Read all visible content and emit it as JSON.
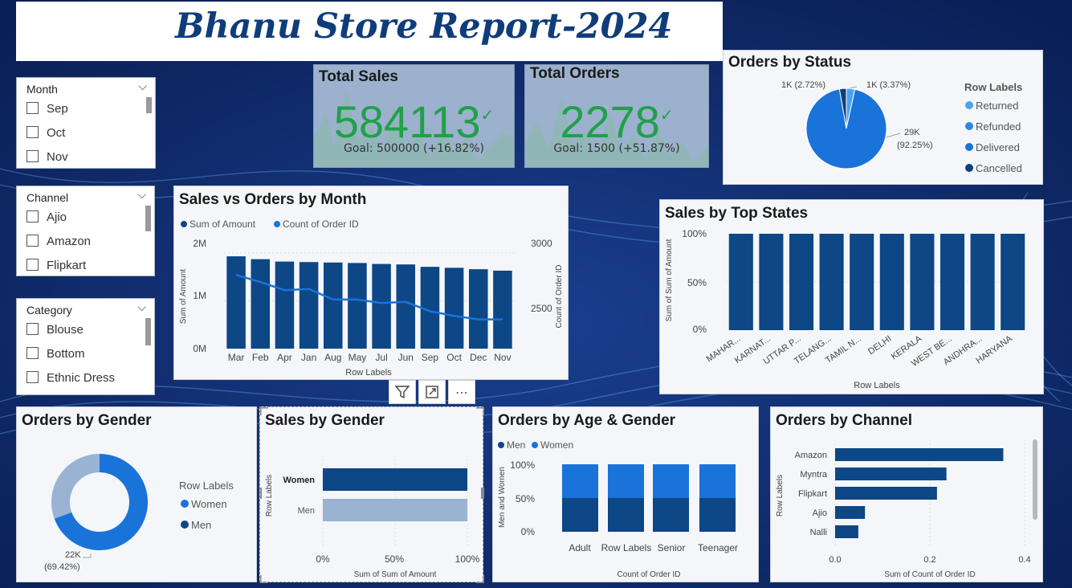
{
  "report_title": "Bhanu Store Report-2024",
  "colors": {
    "dark_blue": "#0d4785",
    "mid_blue": "#1a73d9",
    "light_blue": "#4aa3f0",
    "pale_blue": "#9ab3d3",
    "green": "#20a04a"
  },
  "slicers": [
    {
      "header": "Month",
      "items": [
        "Sep",
        "Oct",
        "Nov"
      ]
    },
    {
      "header": "Channel",
      "items": [
        "Ajio",
        "Amazon",
        "Flipkart"
      ]
    },
    {
      "header": "Category",
      "items": [
        "Blouse",
        "Bottom",
        "Ethnic Dress"
      ]
    }
  ],
  "kpis": {
    "sales": {
      "title": "Total Sales",
      "value": "584113",
      "goal": "Goal: 500000 (+16.82%)",
      "check_icon": "check-icon"
    },
    "orders": {
      "title": "Total Orders",
      "value": "2278",
      "goal": "Goal: 1500 (+51.87%)",
      "check_icon": "check-icon"
    }
  },
  "orders_by_status": {
    "title": "Orders by Status",
    "legend_title": "Row Labels",
    "labels": [
      "1K (2.72%)",
      "1K (3.37%)",
      "29K",
      "(92.25%)"
    ],
    "chart_data": {
      "type": "pie",
      "categories": [
        "Returned",
        "Refunded",
        "Delivered",
        "Cancelled"
      ],
      "values": [
        3.37,
        0.0,
        92.25,
        2.72
      ]
    }
  },
  "sales_vs_orders": {
    "title": "Sales vs Orders by Month",
    "legend": [
      "Sum of Amount",
      "Count of Order ID"
    ],
    "ylabel": "Sum of Amount",
    "y2label": "Count of Order ID",
    "xlabel": "Row Labels",
    "yticks": [
      "2M",
      "1M",
      "0M"
    ],
    "y2ticks": [
      "3000",
      "2500"
    ],
    "chart_data": {
      "type": "bar",
      "categories": [
        "Mar",
        "Feb",
        "Apr",
        "Jan",
        "Aug",
        "May",
        "Jul",
        "Jun",
        "Sep",
        "Oct",
        "Dec",
        "Nov"
      ],
      "series": [
        {
          "name": "Sum of Amount",
          "values": [
            1.93,
            1.87,
            1.82,
            1.81,
            1.8,
            1.79,
            1.77,
            1.76,
            1.71,
            1.69,
            1.66,
            1.63
          ]
        },
        {
          "name": "Count of Order ID",
          "values": [
            2830,
            2770,
            2700,
            2710,
            2620,
            2620,
            2590,
            2600,
            2520,
            2480,
            2450,
            2450
          ]
        }
      ],
      "ylim": [
        0,
        2.2
      ],
      "y2lim": [
        2200,
        3100
      ]
    }
  },
  "top_states": {
    "title": "Sales by Top States",
    "ylabel": "Sum of Sum of Amount",
    "xlabel": "Row Labels",
    "yticks": [
      "100%",
      "50%",
      "0%"
    ],
    "chart_data": {
      "type": "bar",
      "categories": [
        "MAHAR...",
        "KARNAT...",
        "UTTAR P...",
        "TELANG...",
        "TAMIL N...",
        "DELHI",
        "KERALA",
        "WEST BE...",
        "ANDHRA...",
        "HARYANA"
      ],
      "values": [
        100,
        100,
        100,
        100,
        100,
        100,
        100,
        100,
        100,
        100
      ],
      "ylim": [
        0,
        100
      ]
    }
  },
  "orders_by_gender": {
    "title": "Orders by Gender",
    "legend_title": "Row Labels",
    "labels": [
      "22K",
      "(69.42%)"
    ],
    "chart_data": {
      "type": "pie",
      "categories": [
        "Women",
        "Men"
      ],
      "values": [
        69.42,
        30.58
      ]
    }
  },
  "sales_by_gender": {
    "title": "Sales by Gender",
    "ylabel": "Row Labels",
    "xlabel": "Sum of Sum of Amount",
    "xticks": [
      "0%",
      "50%",
      "100%"
    ],
    "chart_data": {
      "type": "bar",
      "categories": [
        "Women",
        "Men"
      ],
      "values": [
        100,
        100
      ],
      "xlim": [
        0,
        100
      ]
    }
  },
  "age_gender": {
    "title": "Orders by Age & Gender",
    "legend": [
      "Men",
      "Women"
    ],
    "ylabel": "Men and Women",
    "xlabel": "Count of Order ID",
    "row_labels": "Row Labels",
    "yticks": [
      "100%",
      "50%",
      "0%"
    ],
    "chart_data": {
      "type": "bar",
      "categories": [
        "Adult",
        "Senior",
        "Teenager"
      ],
      "series": [
        {
          "name": "Men",
          "values": [
            50,
            50,
            50,
            50
          ]
        },
        {
          "name": "Women",
          "values": [
            50,
            50,
            50,
            50
          ]
        }
      ],
      "ylim": [
        0,
        100
      ]
    }
  },
  "orders_by_channel": {
    "title": "Orders by Channel",
    "ylabel": "Row Labels",
    "xlabel": "Sum of Count of Order ID",
    "xticks": [
      "0.0",
      "0.2",
      "0.4"
    ],
    "chart_data": {
      "type": "bar",
      "categories": [
        "Amazon",
        "Myntra",
        "Flipkart",
        "Ajio",
        "Nalli"
      ],
      "values": [
        0.355,
        0.235,
        0.215,
        0.063,
        0.049
      ],
      "xlim": [
        0,
        0.4
      ]
    }
  },
  "visual_toolbar": {
    "filter_icon": "filter-icon",
    "focus_icon": "focus-mode-icon",
    "more_icon": "more-options-icon",
    "more_glyph": "⋯"
  }
}
